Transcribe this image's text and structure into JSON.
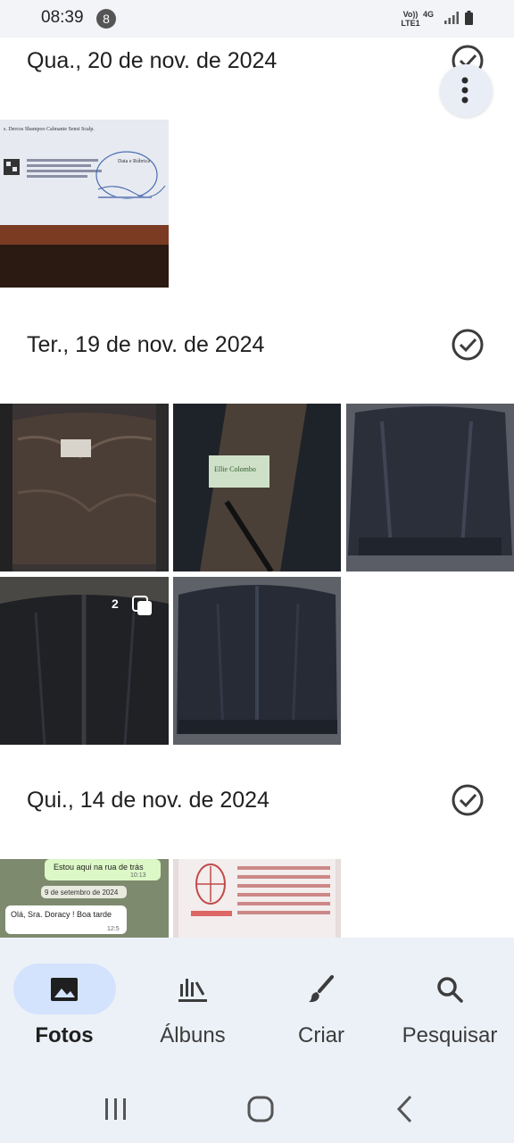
{
  "status_bar": {
    "time": "08:39",
    "notification_count": "8",
    "network_volte": "Vo)) LTE1",
    "network_type": "4G"
  },
  "sections": [
    {
      "date": "Qua., 20 de nov. de 2024"
    },
    {
      "date": "Ter., 19 de nov. de 2024"
    },
    {
      "date": "Qui., 14 de nov. de 2024"
    }
  ],
  "photos": {
    "document_header": "s. Dercos Shampoo Calmante Sensi Scalp.",
    "document_stamp": "Data e Rúbrica",
    "jacket_label": "Ellie Colombo",
    "burst_count": "2",
    "chat_msg_1": "Estou aqui na rua de trás",
    "chat_time_1": "10:13",
    "chat_date_chip": "9 de setembro de 2024",
    "chat_msg_2": "Olá, Sra. Doracy ! Boa tarde",
    "chat_time_2": "12:5"
  },
  "bottom_nav": {
    "items": [
      {
        "label": "Fotos",
        "icon": "photo-icon",
        "active": true
      },
      {
        "label": "Álbuns",
        "icon": "albums-icon",
        "active": false
      },
      {
        "label": "Criar",
        "icon": "brush-icon",
        "active": false
      },
      {
        "label": "Pesquisar",
        "icon": "search-icon",
        "active": false
      }
    ]
  },
  "colors": {
    "accent_pill": "#d3e3fd",
    "nav_background": "#ecf1f7",
    "status_background": "#f2f4f8"
  }
}
